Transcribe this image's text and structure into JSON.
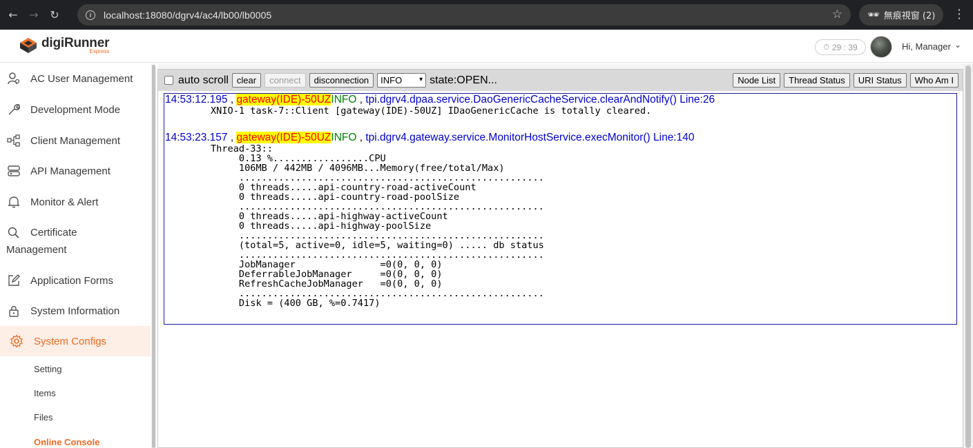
{
  "browser": {
    "url": "localhost:18080/dgrv4/ac4/lb00/lb0005",
    "incognito_label": "無痕視窗 (2)"
  },
  "header": {
    "logo_name": "digiRunner",
    "logo_sub": "Express",
    "timer": "29 : 39",
    "greeting": "Hi, Manager"
  },
  "sidebar": {
    "items": [
      {
        "label": "AC User Management",
        "icon": "user-cog-icon"
      },
      {
        "label": "Development Mode",
        "icon": "wrench-icon"
      },
      {
        "label": "Client Management",
        "icon": "hierarchy-icon"
      },
      {
        "label": "API Management",
        "icon": "api-icon"
      },
      {
        "label": "Monitor & Alert",
        "icon": "bell-icon"
      },
      {
        "label": "Certificate",
        "label2": "Management",
        "icon": "search-icon"
      },
      {
        "label": "Application Forms",
        "icon": "edit-icon"
      },
      {
        "label": "System Information",
        "icon": "lock-icon"
      },
      {
        "label": "System Configs",
        "icon": "gear-icon",
        "active": true
      }
    ],
    "subitems": [
      {
        "label": "Setting"
      },
      {
        "label": "Items"
      },
      {
        "label": "Files"
      },
      {
        "label": "Online Console",
        "active": true
      }
    ]
  },
  "console": {
    "auto_scroll_label": "auto scroll",
    "clear_label": "clear",
    "connect_label": "connect",
    "disconnect_label": "disconnection",
    "level_selected": "INFO",
    "state_text": "state:OPEN...",
    "node_list_label": "Node List",
    "thread_status_label": "Thread Status",
    "uri_status_label": "URI Status",
    "who_am_i_label": "Who Am I",
    "logs": [
      {
        "time": "14:53:12.195",
        "gateway": "gateway(IDE)-50UZ",
        "level": "INFO",
        "source": "tpi.dgrv4.dpaa.service.DaoGenericCacheService.clearAndNotify() Line:26",
        "body": "XNIO-1 task-7::Client [gateway(IDE)-50UZ] IDaoGenericCache is totally cleared."
      },
      {
        "time": "14:53:23.157",
        "gateway": "gateway(IDE)-50UZ",
        "level": "INFO",
        "source": "tpi.dgrv4.gateway.service.MonitorHostService.execMonitor() Line:140",
        "body": "Thread-33::\n     0.13 %.................CPU\n     106MB / 442MB / 4096MB...Memory(free/total/Max)\n     ......................................................\n     0 threads.....api-country-road-activeCount\n     0 threads.....api-country-road-poolSize\n     ......................................................\n     0 threads.....api-highway-activeCount\n     0 threads.....api-highway-poolSize\n     ......................................................\n     (total=5, active=0, idle=5, waiting=0) ..... db status\n     ......................................................\n     JobManager               =0(0, 0, 0)\n     DeferrableJobManager     =0(0, 0, 0)\n     RefreshCacheJobManager   =0(0, 0, 0)\n     ......................................................\n     Disk = (400 GB, %=0.7417)"
      }
    ]
  }
}
